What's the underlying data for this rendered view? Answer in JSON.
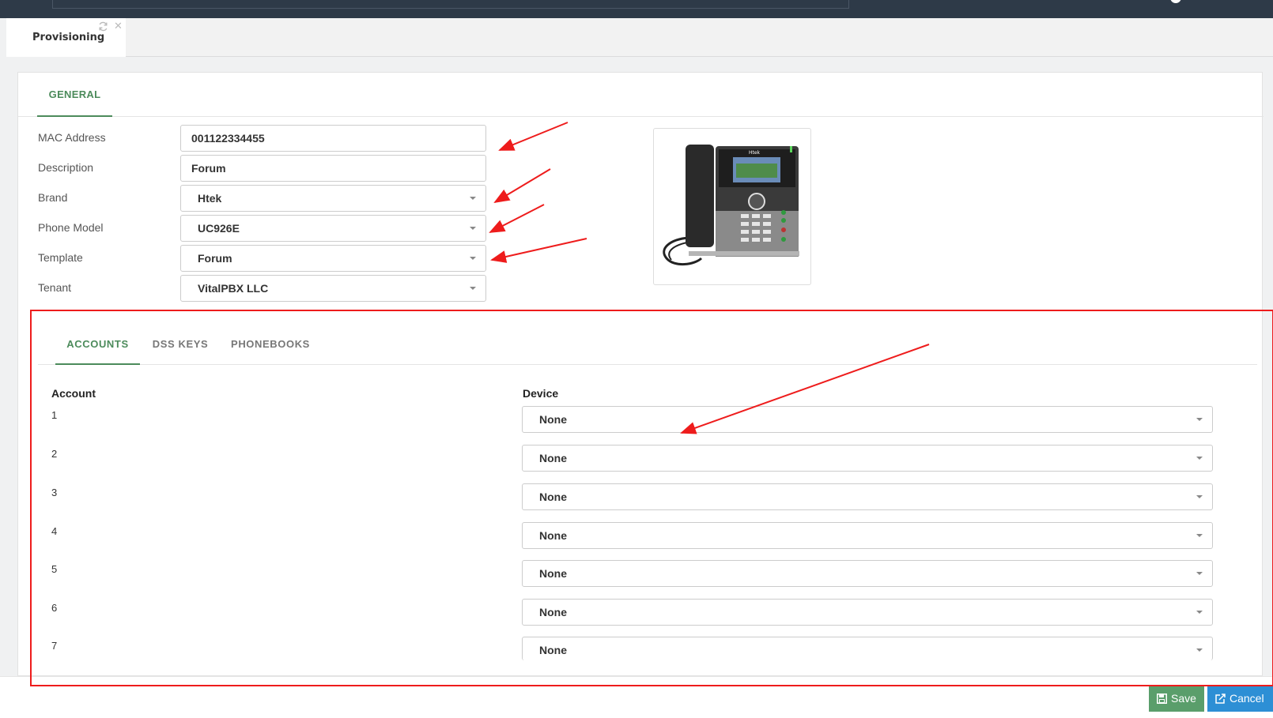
{
  "tab": {
    "label": "Provisioning"
  },
  "general_tab": "GENERAL",
  "fields": [
    {
      "label": "MAC Address",
      "value": "001122334455",
      "type": "input"
    },
    {
      "label": "Description",
      "value": "Forum",
      "type": "input"
    },
    {
      "label": "Brand",
      "value": "Htek",
      "type": "select"
    },
    {
      "label": "Phone Model",
      "value": "UC926E",
      "type": "select"
    },
    {
      "label": "Template",
      "value": "Forum",
      "type": "select"
    },
    {
      "label": "Tenant",
      "value": "VitalPBX LLC",
      "type": "select"
    }
  ],
  "phone_brand_text": "Htek",
  "sub_tabs": [
    "ACCOUNTS",
    "DSS KEYS",
    "PHONEBOOKS"
  ],
  "accounts": {
    "col_account": "Account",
    "col_device": "Device",
    "rows": [
      {
        "num": "1",
        "device": "None"
      },
      {
        "num": "2",
        "device": "None"
      },
      {
        "num": "3",
        "device": "None"
      },
      {
        "num": "4",
        "device": "None"
      },
      {
        "num": "5",
        "device": "None"
      },
      {
        "num": "6",
        "device": "None"
      },
      {
        "num": "7",
        "device": "None"
      }
    ]
  },
  "buttons": {
    "save": "Save",
    "cancel": "Cancel"
  },
  "colors": {
    "accent_green": "#4c8b5b",
    "save_green": "#5a9e6b",
    "cancel_blue": "#2d8fd5",
    "annotation_red": "#ee1c1c",
    "topbar": "#2e3a48"
  }
}
